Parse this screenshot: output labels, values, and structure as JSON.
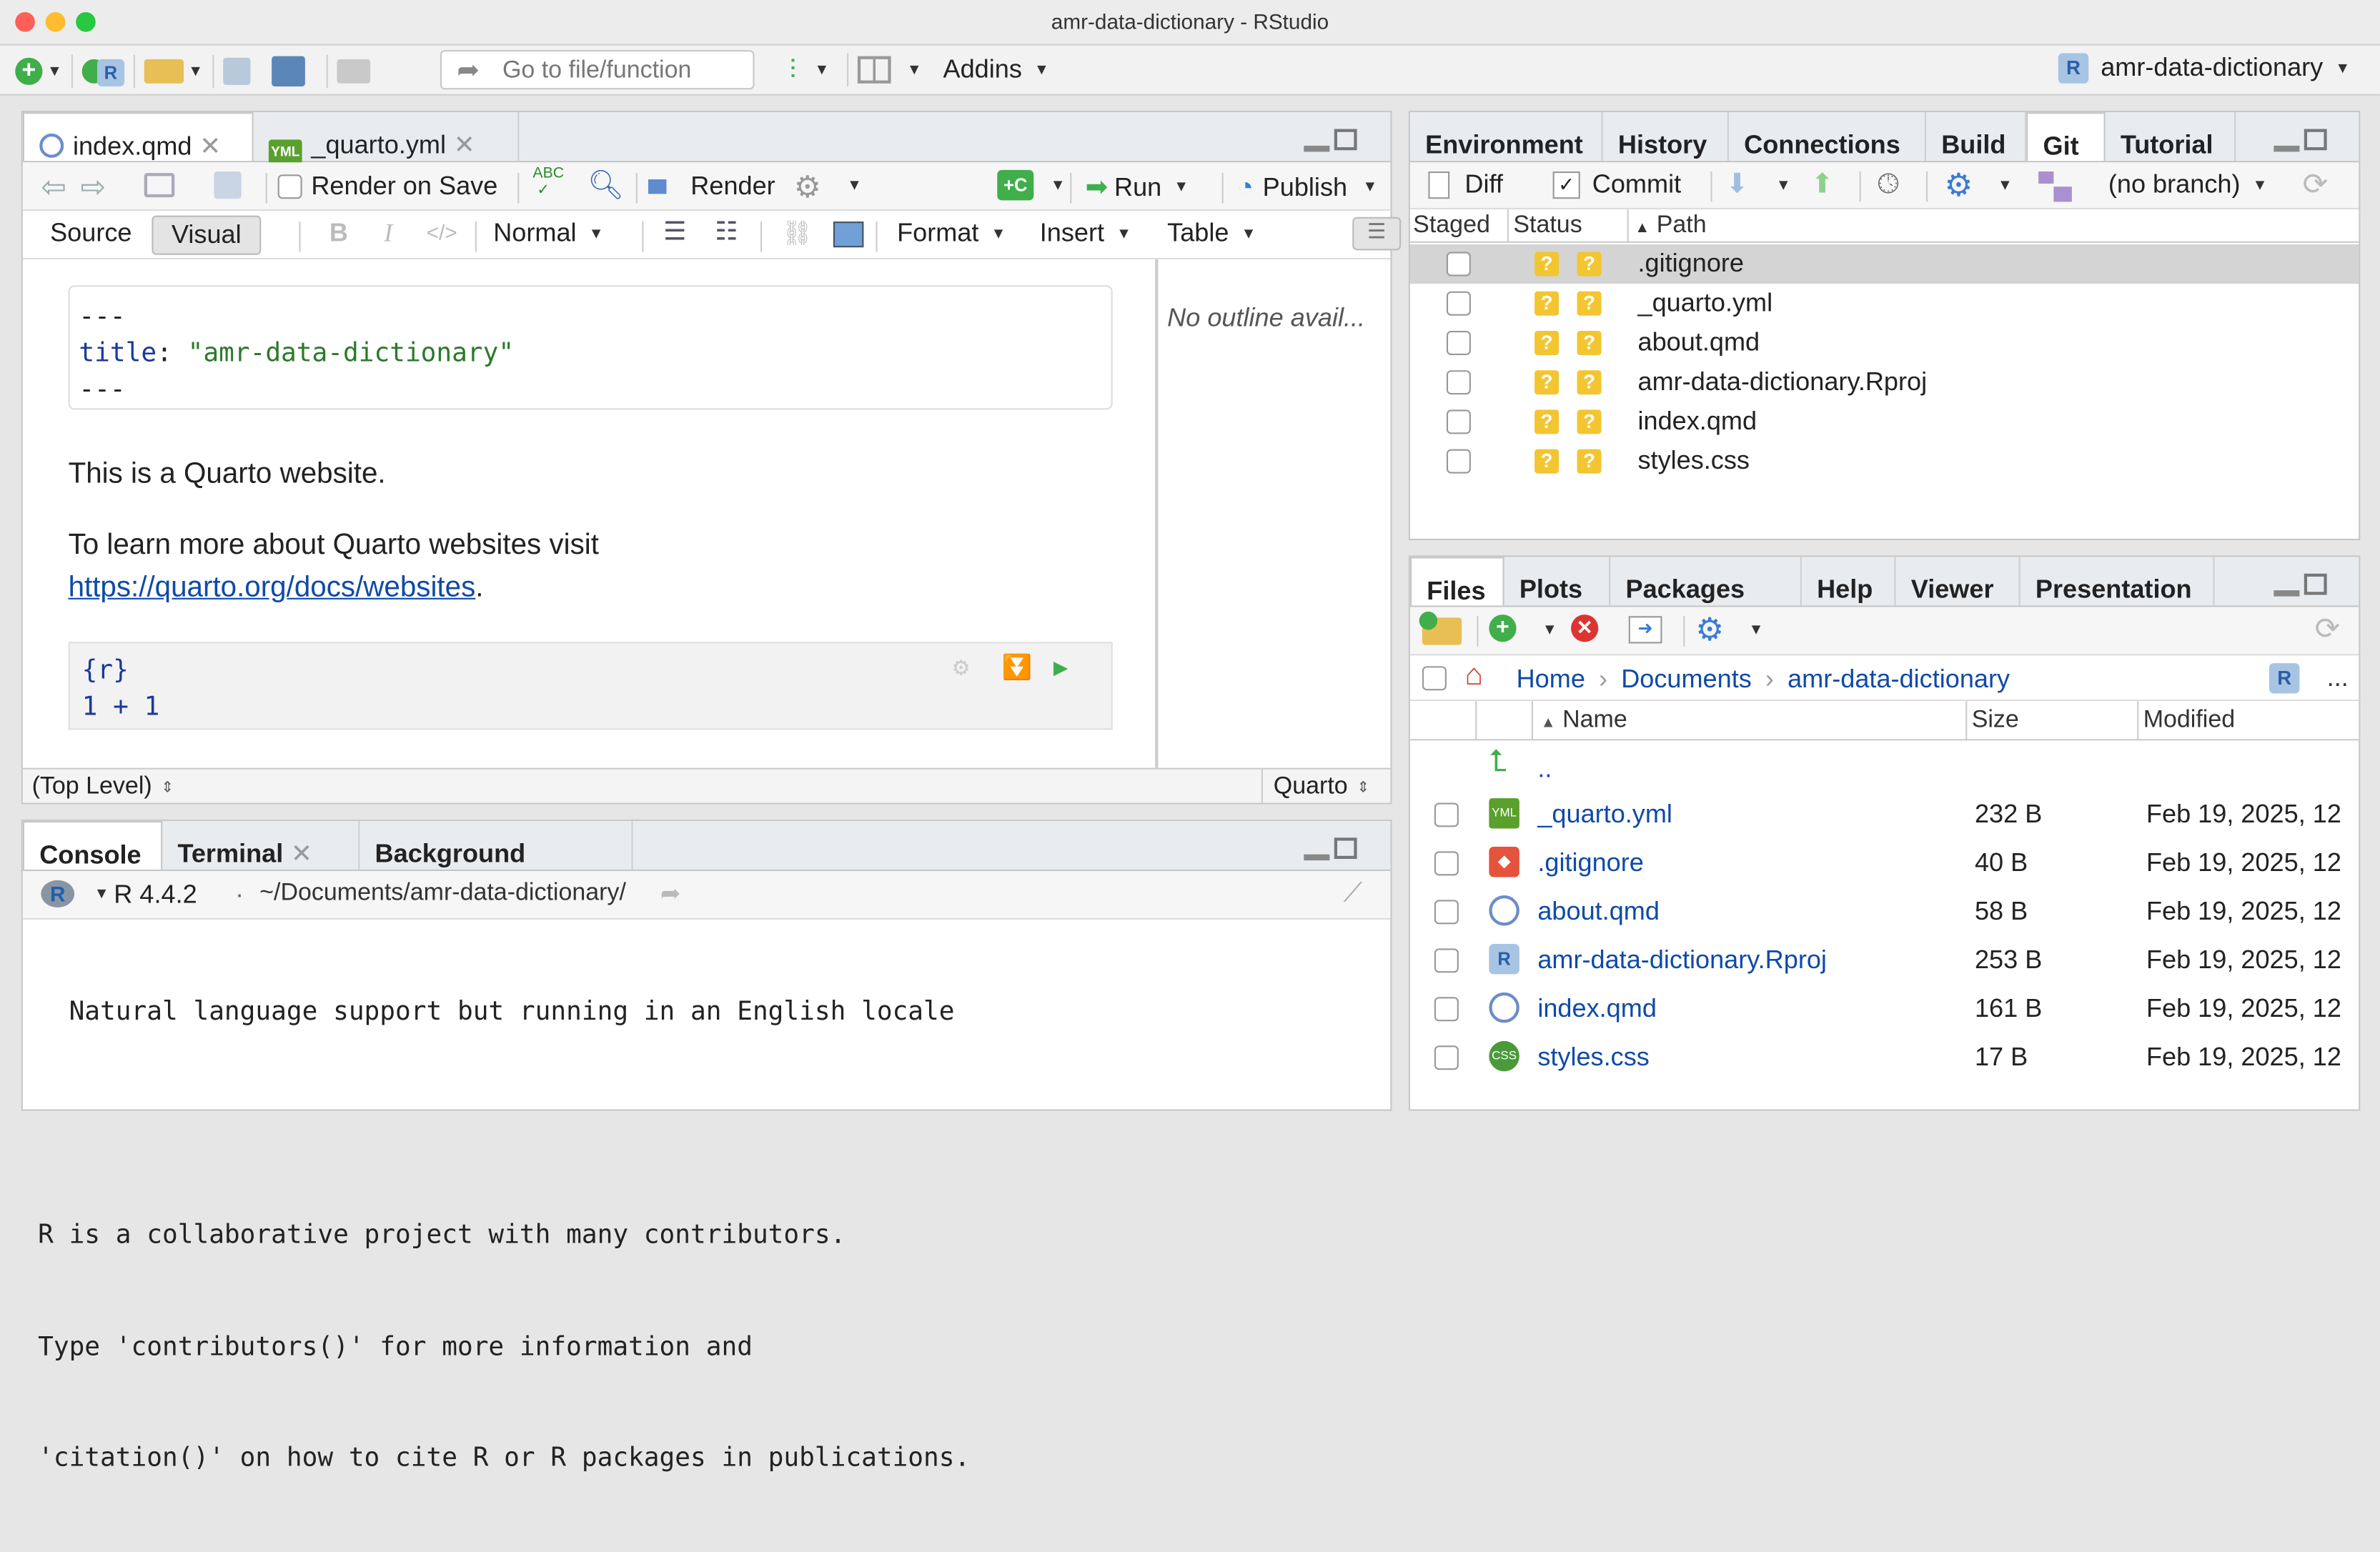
{
  "window": {
    "title": "amr-data-dictionary - RStudio"
  },
  "toolbar": {
    "goto_placeholder": "Go to file/function",
    "addins_label": "Addins",
    "project_label": "amr-data-dictionary"
  },
  "editor": {
    "tabs": [
      {
        "label": "index.qmd"
      },
      {
        "label": "_quarto.yml"
      }
    ],
    "render_on_save_label": "Render on Save",
    "render_label": "Render",
    "run_label": "Run",
    "publish_label": "Publish",
    "source_label": "Source",
    "visual_label": "Visual",
    "style_select": "Normal",
    "format_label": "Format",
    "insert_label": "Insert",
    "table_label": "Table",
    "yaml": {
      "dashes": "---",
      "key": "title",
      "value": "\"amr-data-dictionary\""
    },
    "para1": "This is a Quarto website.",
    "para2": "To learn more about Quarto websites visit",
    "link": "https://quarto.org/docs/websites",
    "period": ".",
    "chunk_header": "{r}",
    "chunk_code": "1 + 1",
    "outline_text": "No outline avail...",
    "status_left": "(Top Level)",
    "status_right": "Quarto"
  },
  "console": {
    "tabs": [
      {
        "label": "Console"
      },
      {
        "label": "Terminal"
      },
      {
        "label": "Background Jobs"
      }
    ],
    "r_version": "R 4.4.2",
    "dot": "·",
    "path": "~/Documents/amr-data-dictionary/",
    "lines": [
      "  Natural language support but running in an English locale",
      "",
      "R is a collaborative project with many contributors.",
      "Type 'contributors()' for more information and",
      "'citation()' on how to cite R or R packages in publications."
    ]
  },
  "env_pane": {
    "tabs": [
      {
        "label": "Environment"
      },
      {
        "label": "History"
      },
      {
        "label": "Connections"
      },
      {
        "label": "Build"
      },
      {
        "label": "Git"
      },
      {
        "label": "Tutorial"
      }
    ],
    "diff_label": "Diff",
    "commit_label": "Commit",
    "branch_label": "(no branch)",
    "headers": {
      "staged": "Staged",
      "status": "Status",
      "path": "Path"
    },
    "files": [
      {
        "path": ".gitignore"
      },
      {
        "path": "_quarto.yml"
      },
      {
        "path": "about.qmd"
      },
      {
        "path": "amr-data-dictionary.Rproj"
      },
      {
        "path": "index.qmd"
      },
      {
        "path": "styles.css"
      }
    ],
    "status_glyph": "?"
  },
  "files_pane": {
    "tabs": [
      {
        "label": "Files"
      },
      {
        "label": "Plots"
      },
      {
        "label": "Packages"
      },
      {
        "label": "Help"
      },
      {
        "label": "Viewer"
      },
      {
        "label": "Presentation"
      }
    ],
    "breadcrumb": {
      "home": "Home",
      "sep": "›",
      "documents": "Documents",
      "project": "amr-data-dictionary"
    },
    "more": "...",
    "headers": {
      "name": "Name",
      "size": "Size",
      "modified": "Modified"
    },
    "parent": "..",
    "files": [
      {
        "name": "_quarto.yml",
        "size": "232 B",
        "modified": "Feb 19, 2025, 12",
        "icon": "yml"
      },
      {
        "name": ".gitignore",
        "size": "40 B",
        "modified": "Feb 19, 2025, 12",
        "icon": "git"
      },
      {
        "name": "about.qmd",
        "size": "58 B",
        "modified": "Feb 19, 2025, 12",
        "icon": "qmd"
      },
      {
        "name": "amr-data-dictionary.Rproj",
        "size": "253 B",
        "modified": "Feb 19, 2025, 12",
        "icon": "rproj"
      },
      {
        "name": "index.qmd",
        "size": "161 B",
        "modified": "Feb 19, 2025, 12",
        "icon": "qmd"
      },
      {
        "name": "styles.css",
        "size": "17 B",
        "modified": "Feb 19, 2025, 12",
        "icon": "css"
      }
    ]
  }
}
